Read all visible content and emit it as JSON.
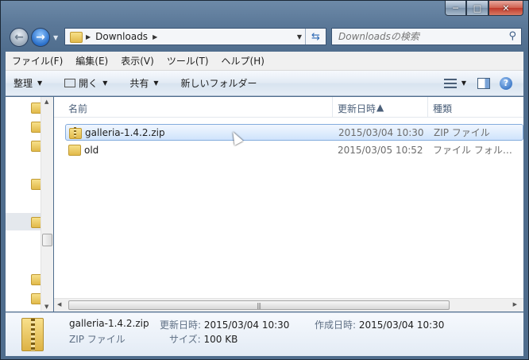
{
  "window": {
    "caption_buttons": [
      "─",
      "□",
      "✕"
    ]
  },
  "nav": {
    "back_icon": "back-arrow-icon",
    "forward_icon": "forward-arrow-icon"
  },
  "address": {
    "path": "Downloads"
  },
  "search": {
    "placeholder": "Downloadsの検索"
  },
  "menu": [
    "ファイル(F)",
    "編集(E)",
    "表示(V)",
    "ツール(T)",
    "ヘルプ(H)"
  ],
  "toolbar": {
    "organize": "整理",
    "open": "開く",
    "share": "共有",
    "new_folder": "新しいフォルダー"
  },
  "columns": {
    "name": "名前",
    "date": "更新日時",
    "type": "種類"
  },
  "files": [
    {
      "name": "galleria-1.4.2.zip",
      "date": "2015/03/04 10:30",
      "type": "ZIP ファイル",
      "selected": true
    },
    {
      "name": "old",
      "date": "2015/03/05 10:52",
      "type": "ファイル フォル…",
      "selected": false
    }
  ],
  "details": {
    "name": "galleria-1.4.2.zip",
    "type": "ZIP ファイル",
    "modified_label": "更新日時:",
    "modified": "2015/03/04 10:30",
    "created_label": "作成日時:",
    "created": "2015/03/04 10:30",
    "size_label": "サイズ:",
    "size": "100 KB"
  },
  "colors": {
    "accent": "#2a6fc9",
    "selection": "#cfe3fc"
  }
}
